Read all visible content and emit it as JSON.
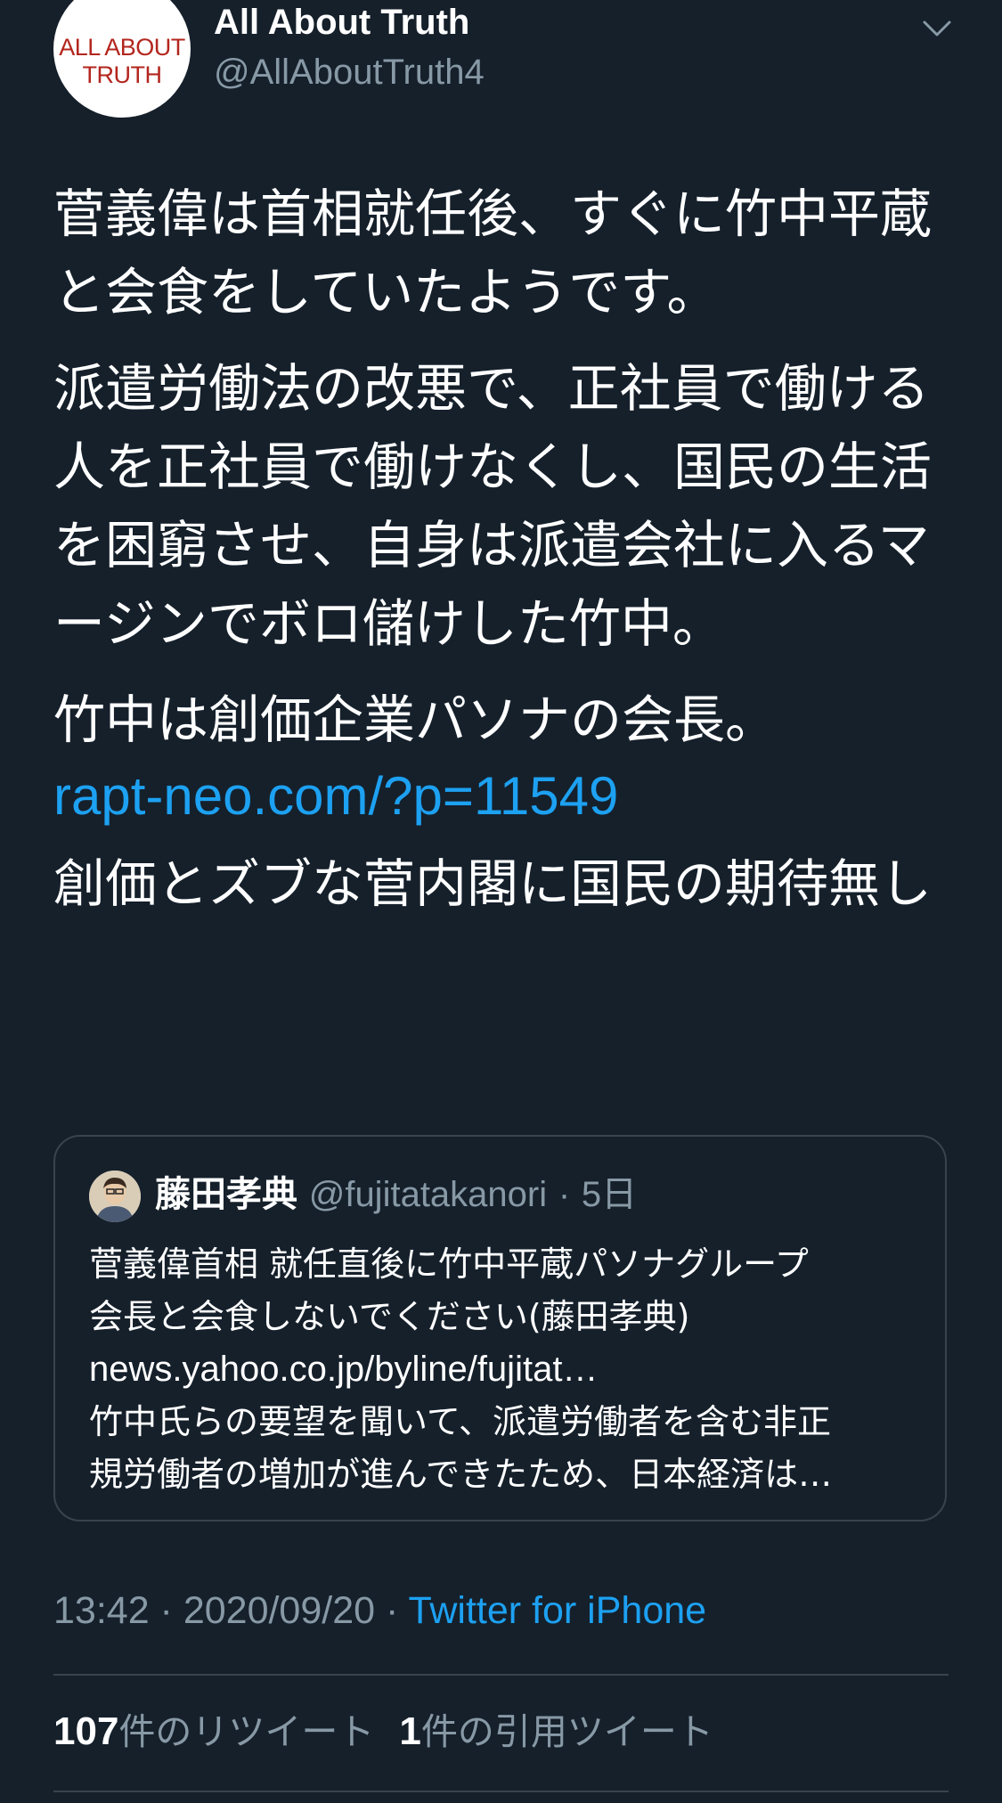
{
  "header": {
    "avatar_line1": "ALL ABOUT",
    "avatar_line2": "TRUTH",
    "display_name": "All About Truth",
    "handle": "@AllAboutTruth4",
    "menu_icon": "chevron-down-icon"
  },
  "tweet": {
    "paragraphs": [
      "菅義偉は首相就任後、すぐに竹中平蔵と会食をしていたようです。",
      "派遣労働法の改悪で、正社員で働ける人を正社員で働けなくし、国民の生活を困窮させ、自身は派遣会社に入るマージンでボロ儲けした竹中。",
      "竹中は創価企業パソナの会長。",
      "rapt-neo.com/?p=11549",
      "創価とズブな菅内閣に国民の期待無し"
    ]
  },
  "quote": {
    "name": "藤田孝典",
    "handle": "@fujitatakanori",
    "separator": "·",
    "time": "5日",
    "lines": [
      "菅義偉首相 就任直後に竹中平蔵パソナグループ",
      "会長と会食しないでください(藤田孝典)",
      "news.yahoo.co.jp/byline/fujitat…",
      "竹中氏らの要望を聞いて、派遣労働者を含む非正",
      "規労働者の増加が進んできたため、日本経済は…"
    ]
  },
  "meta": {
    "time": "13:42",
    "sep1": " · ",
    "date": "2020/09/20",
    "sep2": " · ",
    "source": "Twitter for iPhone"
  },
  "stats": {
    "retweets_count": "107",
    "retweets_label": "件のリツイート",
    "quotes_count": "1",
    "quotes_label": "件の引用ツイート"
  },
  "colors": {
    "background": "#15202b",
    "link": "#1da1f2",
    "secondary_text": "#8899a6",
    "border": "#38444d"
  }
}
